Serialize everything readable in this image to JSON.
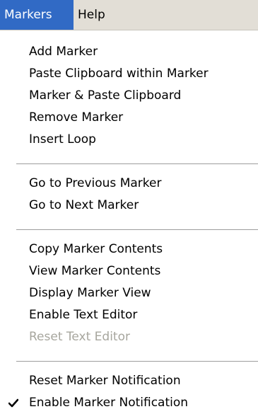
{
  "menubar": {
    "items": [
      {
        "label": "Markers"
      },
      {
        "label": "Help"
      }
    ]
  },
  "menu": {
    "groups": [
      {
        "items": [
          {
            "label": "Add Marker"
          },
          {
            "label": "Paste Clipboard within Marker"
          },
          {
            "label": "Marker & Paste Clipboard"
          },
          {
            "label": "Remove Marker"
          },
          {
            "label": "Insert Loop"
          }
        ]
      },
      {
        "items": [
          {
            "label": "Go to Previous Marker"
          },
          {
            "label": "Go to Next Marker"
          }
        ]
      },
      {
        "items": [
          {
            "label": "Copy Marker Contents"
          },
          {
            "label": "View Marker Contents"
          },
          {
            "label": "Display Marker View"
          },
          {
            "label": "Enable Text Editor"
          },
          {
            "label": "Reset Text Editor",
            "disabled": true
          }
        ]
      },
      {
        "items": [
          {
            "label": "Reset Marker Notification"
          },
          {
            "label": "Enable Marker Notification",
            "checked": true,
            "icon": "checkmark-icon"
          }
        ]
      }
    ]
  },
  "colors": {
    "menubar_bg": "#e2ded6",
    "active_bg": "#316ac5",
    "disabled_text": "#a7a69e",
    "separator": "#9d9d9d"
  }
}
